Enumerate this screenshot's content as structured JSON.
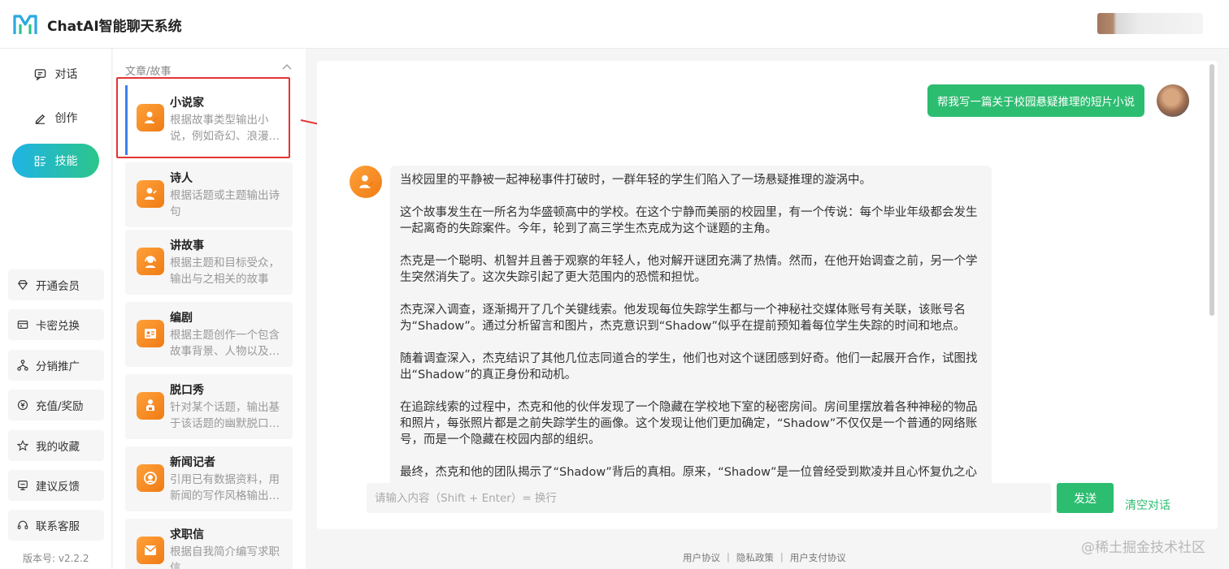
{
  "header": {
    "app_title": "ChatAI智能聊天系统"
  },
  "nav": [
    {
      "label": "对话",
      "icon": "chat-icon"
    },
    {
      "label": "创作",
      "icon": "edit-icon"
    },
    {
      "label": "技能",
      "icon": "skill-list-icon"
    }
  ],
  "side_buttons": [
    {
      "label": "开通会员",
      "icon": "diamond-icon"
    },
    {
      "label": "卡密兑换",
      "icon": "card-icon"
    },
    {
      "label": "分销推广",
      "icon": "share-icon"
    },
    {
      "label": "充值/奖励",
      "icon": "recharge-icon"
    },
    {
      "label": "我的收藏",
      "icon": "star-icon"
    },
    {
      "label": "建议反馈",
      "icon": "feedback-icon"
    },
    {
      "label": "联系客服",
      "icon": "headset-icon"
    }
  ],
  "version": "版本号: v2.2.2",
  "skills": {
    "section_title": "文章/故事",
    "items": [
      {
        "name": "小说家",
        "desc": "根据故事类型输出小说，例如奇幻、浪漫…",
        "icon": "novelist-icon"
      },
      {
        "name": "诗人",
        "desc": "根据话题或主题输出诗句",
        "icon": "poet-icon"
      },
      {
        "name": "讲故事",
        "desc": "根据主题和目标受众，输出与之相关的故事",
        "icon": "storyteller-icon"
      },
      {
        "name": "编剧",
        "desc": "根据主题创作一个包含故事背景、人物以及…",
        "icon": "screenwriter-icon"
      },
      {
        "name": "脱口秀",
        "desc": "针对某个话题，输出基于该话题的幽默脱口…",
        "icon": "standup-icon"
      },
      {
        "name": "新闻记者",
        "desc": "引用已有数据资料，用新闻的写作风格输出…",
        "icon": "reporter-icon"
      },
      {
        "name": "求职信",
        "desc": "根据自我简介编写求职信",
        "icon": "cover-letter-icon"
      }
    ]
  },
  "chat": {
    "user_message": "帮我写一篇关于校园悬疑推理的短片小说",
    "bot_paragraphs": [
      "当校园里的平静被一起神秘事件打破时，一群年轻的学生们陷入了一场悬疑推理的漩涡中。",
      "这个故事发生在一所名为华盛顿高中的学校。在这个宁静而美丽的校园里，有一个传说：每个毕业年级都会发生一起离奇的失踪案件。今年，轮到了高三学生杰克成为这个谜题的主角。",
      "杰克是一个聪明、机智并且善于观察的年轻人，他对解开谜团充满了热情。然而，在他开始调查之前，另一个学生突然消失了。这次失踪引起了更大范围内的恐慌和担忧。",
      "杰克深入调查，逐渐揭开了几个关键线索。他发现每位失踪学生都与一个神秘社交媒体账号有关联，该账号名为“Shadow”。通过分析留言和图片，杰克意识到“Shadow”似乎在提前预知着每位学生失踪的时间和地点。",
      "随着调查深入，杰克结识了其他几位志同道合的学生，他们也对这个谜团感到好奇。他们一起展开合作，试图找出“Shadow”的真正身份和动机。",
      "在追踪线索的过程中，杰克和他的伙伴发现了一个隐藏在学校地下室的秘密房间。房间里摆放着各种神秘的物品和照片，每张照片都是之前失踪学生的画像。这个发现让他们更加确定，“Shadow”不仅仅是一个普通的网络账号，而是一个隐藏在校园内部的组织。",
      "最终，杰克和他的团队揭示了“Shadow”背后的真相。原来，“Shadow”是一位曾经受到欺凌并且心怀复仇之心"
    ],
    "input_placeholder": "请输入内容（Shift + Enter）= 换行",
    "send_label": "发送",
    "clear_label": "清空对话"
  },
  "footer": {
    "links": [
      "用户协议",
      "隐私政策",
      "用户支付协议"
    ],
    "separator": "|"
  },
  "watermark": "@稀土掘金技术社区",
  "colors": {
    "primary_green": "#2dbd71",
    "skill_orange": "#f58b22",
    "highlight_red": "#e53333",
    "nav_gradient_start": "#1fb3e5"
  }
}
